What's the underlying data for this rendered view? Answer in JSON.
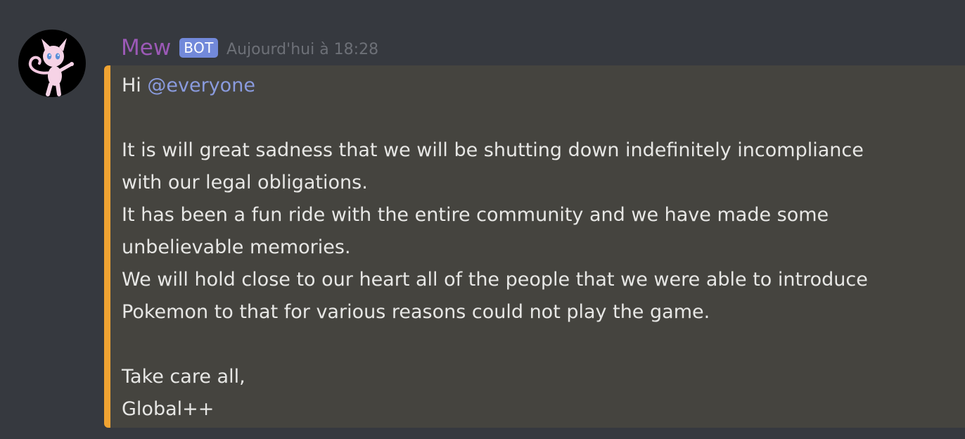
{
  "message": {
    "author": "Mew",
    "bot_tag": "BOT",
    "timestamp": "Aujourd'hui à 18:28",
    "avatar_icon": "mew-avatar-icon",
    "embed": {
      "accent_color": "#f0a332",
      "greeting": "Hi",
      "mention": "@everyone",
      "lines": [
        "It is will great sadness that we will be shutting down indefinitely incompliance",
        "with our legal obligations.",
        "It has been a fun ride with the entire community and we have made some",
        "unbelievable memories.",
        "We will hold close to our heart all of the people that we were able to introduce",
        "Pokemon to that for various reasons could not play the game."
      ],
      "signoff": "Take care all,",
      "signature": "Global++"
    }
  },
  "colors": {
    "background": "#36393f",
    "username": "#9b59b6",
    "bot_tag": "#7289da",
    "mention": "#8a9bde",
    "embed_background": "#45443f"
  }
}
